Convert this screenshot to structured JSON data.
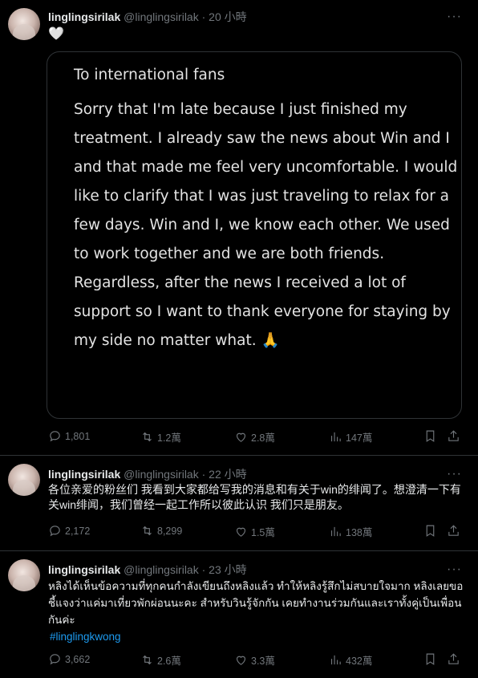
{
  "tweets": [
    {
      "name": "linglingsirilak",
      "handle": "@linglingsirilak · 20 小時",
      "text": "🤍",
      "media": {
        "title": "To international fans",
        "text": "Sorry that I'm late because I just finished my treatment. I already saw the news about Win and I and that made me feel very uncomfortable. I would like to clarify that I was just traveling to relax for a few days. Win and I, we know each other. We used to work together and we are both friends. Regardless, after the news I received a lot of support so I want to thank everyone for staying by my side no matter what.",
        "emoji": "🙏"
      },
      "replies": "1,801",
      "retweets": "1.2萬",
      "likes": "2.8萬",
      "views": "147萬"
    },
    {
      "name": "linglingsirilak",
      "handle": "@linglingsirilak · 22 小時",
      "text": "各位亲爱的粉丝们 我看到大家都给写我的消息和有关于win的绯闻了。想澄清一下有关win绯闻，我们曾经一起工作所以彼此认识 我们只是朋友。",
      "replies": "2,172",
      "retweets": "8,299",
      "likes": "1.5萬",
      "views": "138萬"
    },
    {
      "name": "linglingsirilak",
      "handle": "@linglingsirilak · 23 小時",
      "text": "หลิงได้เห็นข้อความที่ทุกคนกำลังเขียนถึงหลิงแล้ว ทำให้หลิงรู้สึกไม่สบายใจมาก หลิงเลยขอชี้แจงว่าแค่มาเที่ยวพักผ่อนนะคะ สำหรับวินรู้จักกัน เคยทำงานร่วมกันและเราทั้งคู่เป็นเพื่อนกันค่ะ",
      "hashtag": "#linglingkwong",
      "replies": "3,662",
      "retweets": "2.6萬",
      "likes": "3.3萬",
      "views": "432萬"
    }
  ],
  "icons": {
    "reply": "reply-icon",
    "retweet": "retweet-icon",
    "like": "heart-icon",
    "views": "views-icon",
    "bookmark": "bookmark-icon",
    "share": "share-icon",
    "more": "more-icon"
  },
  "colors": {
    "background": "#000000",
    "text": "#e7e9ea",
    "muted": "#71767b",
    "link": "#1d9bf0",
    "border": "#2f3336"
  }
}
